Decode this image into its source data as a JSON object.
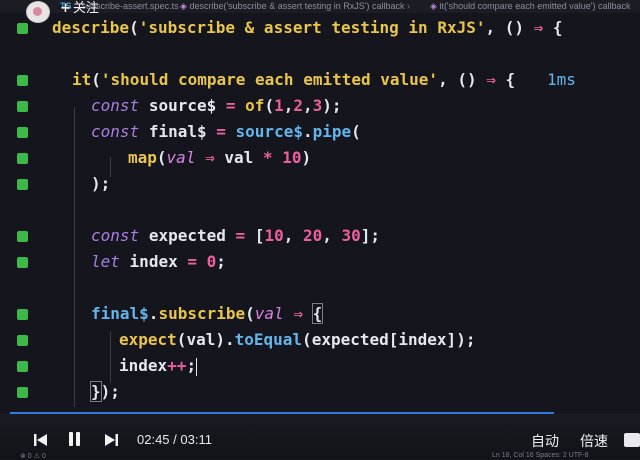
{
  "breadcrumb": {
    "file": "...subscribe-assert.spec.ts",
    "describe": "describe('subscribe & assert testing in RxJS') callback",
    "it": "it('should compare each emitted value') callback"
  },
  "overlay": {
    "follow_label": "关注"
  },
  "code": {
    "l1": {
      "fn": "describe",
      "str": "'subscribe & assert testing in RxJS'"
    },
    "l2": {
      "fn": "it",
      "str": "'should compare each emitted value'",
      "duration": "1ms"
    },
    "l3": {
      "kw": "const",
      "name": "source$",
      "call": "of",
      "args": [
        "1",
        "2",
        "3"
      ]
    },
    "l4": {
      "kw": "const",
      "name": "final$",
      "obj": "source$",
      "method": "pipe"
    },
    "l5": {
      "fn": "map",
      "param": "val",
      "body_var": "val",
      "op": "*",
      "num": "10"
    },
    "l7": {
      "kw": "const",
      "name": "expected",
      "values": [
        "10",
        "20",
        "30"
      ]
    },
    "l8": {
      "kw": "let",
      "name": "index",
      "num": "0"
    },
    "l9": {
      "obj": "final$",
      "method": "subscribe",
      "param": "val"
    },
    "l10": {
      "fn": "expect",
      "arg": "val",
      "method": "toEqual",
      "arg2": "expected[index]"
    },
    "l11": {
      "name": "index",
      "op": "++"
    }
  },
  "player": {
    "current_time": "02:45",
    "total_time": "03:11",
    "progress_fraction": 0.864,
    "auto_label": "自动",
    "speed_label": "倍速",
    "status_left": "⊗ 0 ⚠ 0",
    "status_right": "Ln 18, Col 16   Spaces: 2   UTF-8"
  },
  "colors": {
    "background": "#15161d",
    "function": "#e9c54b",
    "keyword": "#a87ee0",
    "number": "#ec5f9c",
    "method": "#63b5ec",
    "gutter_mark": "#3fb84a",
    "progress": "#2f79d8"
  }
}
